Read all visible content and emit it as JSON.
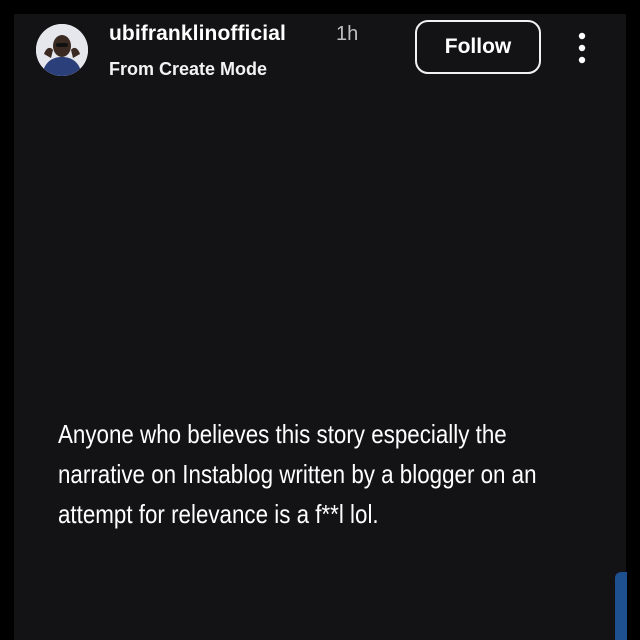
{
  "post": {
    "username": "ubifranklinofficial",
    "timestamp": "1h",
    "subtitle": "From Create Mode",
    "follow_label": "Follow",
    "more_icon": "more-vertical-icon",
    "text": "Anyone who believes this story especially the narrative on Instablog written by a blogger on an attempt for relevance is a f**l lol."
  },
  "colors": {
    "background": "#000000",
    "story_background": "#131315",
    "text": "#ffffff",
    "secondary_text": "#bfbfbf",
    "edge_accent": "#1e4f8f"
  }
}
